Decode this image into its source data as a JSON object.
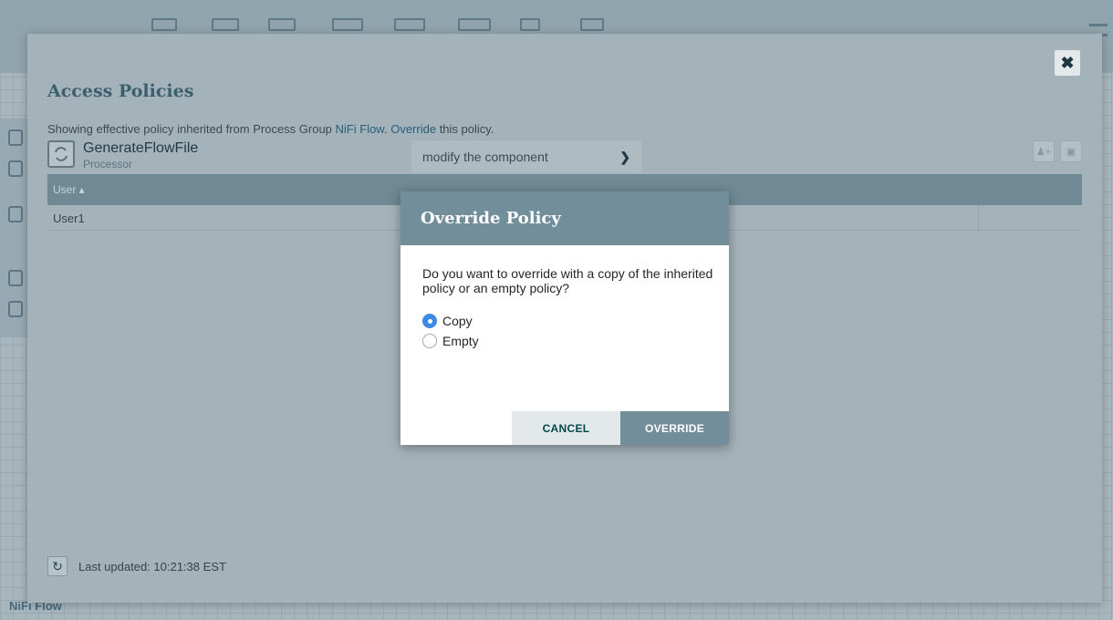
{
  "background": {
    "breadcrumb": "NiFi Flow"
  },
  "policies_dialog": {
    "title": "Access Policies",
    "message": {
      "prefix": "Showing effective policy inherited from Process Group ",
      "group_link": "NiFi Flow",
      "middle": ". ",
      "override_link": "Override",
      "suffix": " this policy."
    },
    "component": {
      "name": "GenerateFlowFile",
      "type": "Processor"
    },
    "action_select": {
      "selected": "modify the component"
    },
    "table": {
      "columns": [
        "User ▴"
      ],
      "rows": [
        {
          "user": "User1"
        }
      ]
    },
    "last_updated_label": "Last updated: 10:21:38 EST"
  },
  "override_dialog": {
    "title": "Override Policy",
    "question": "Do you want to override with a copy of the inherited policy or an empty policy?",
    "options": [
      {
        "label": "Copy",
        "checked": true
      },
      {
        "label": "Empty",
        "checked": false
      }
    ],
    "cancel_label": "CANCEL",
    "override_label": "OVERRIDE"
  },
  "colors": {
    "header": "#728e9b",
    "radio_selected": "#3b8ae3",
    "cancel_text": "#004849"
  }
}
